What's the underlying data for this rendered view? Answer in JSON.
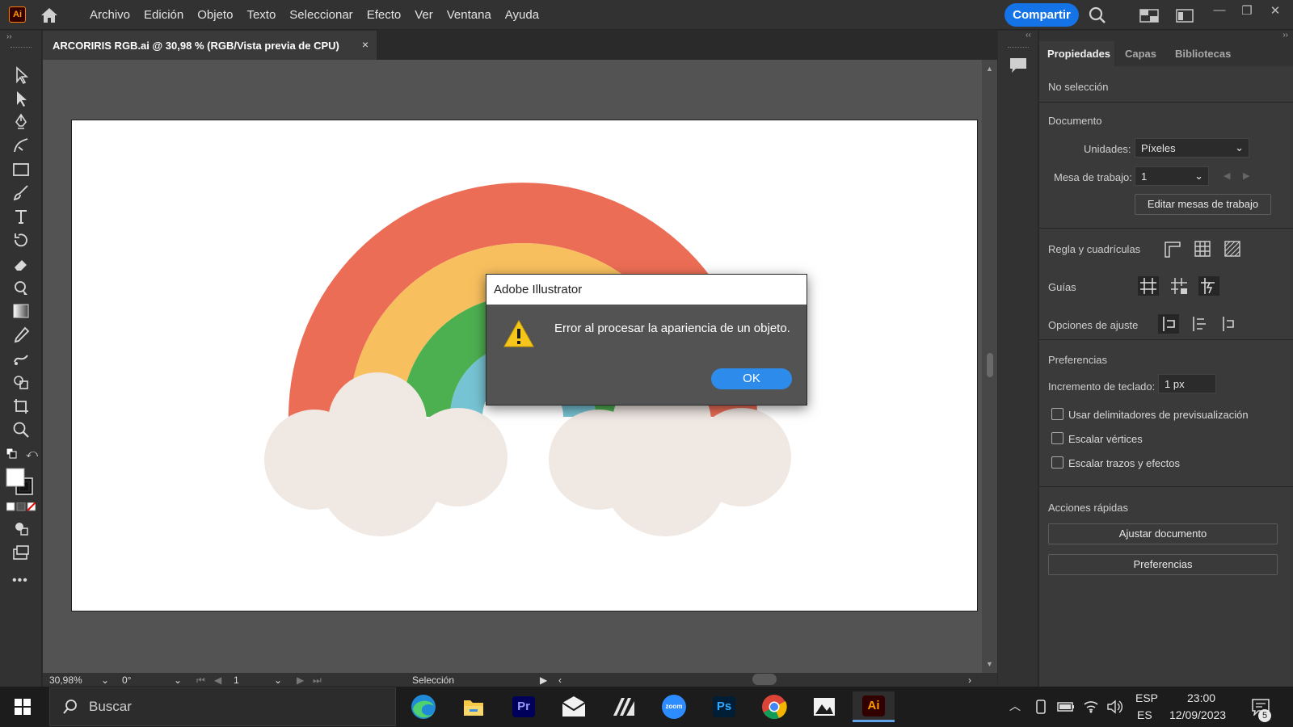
{
  "app": {
    "logo_text": "Ai",
    "menus": [
      "Archivo",
      "Edición",
      "Objeto",
      "Texto",
      "Seleccionar",
      "Efecto",
      "Ver",
      "Ventana",
      "Ayuda"
    ],
    "share_label": "Compartir"
  },
  "document_tab": {
    "title": "ARCORIRIS RGB.ai @ 30,98 % (RGB/Vista previa de CPU)",
    "close": "×"
  },
  "statusbar": {
    "zoom": "30,98%",
    "rotation": "0°",
    "artboard_number": "1",
    "tool_name": "Selección"
  },
  "panel": {
    "tabs": [
      "Propiedades",
      "Capas",
      "Bibliotecas"
    ],
    "active_tab": "Propiedades",
    "no_selection": "No selección",
    "documento": "Documento",
    "units_label": "Unidades:",
    "units_value": "Píxeles",
    "artboard_label": "Mesa de trabajo:",
    "artboard_value": "1",
    "edit_artboards": "Editar mesas de trabajo",
    "rulers_grids": "Regla y cuadrículas",
    "guides": "Guías",
    "snap_options": "Opciones de ajuste",
    "preferences": "Preferencias",
    "keyboard_increment_label": "Incremento de teclado:",
    "keyboard_increment_value": "1 px",
    "checkboxes": [
      {
        "label": "Usar delimitadores de previsualización",
        "checked": false
      },
      {
        "label": "Escalar vértices",
        "checked": false
      },
      {
        "label": "Escalar trazos y efectos",
        "checked": false
      }
    ],
    "quick_actions": "Acciones rápidas",
    "fit_document": "Ajustar documento",
    "preferences_button": "Preferencias"
  },
  "dialog": {
    "title": "Adobe Illustrator",
    "message": "Error al procesar la apariencia de un objeto.",
    "ok_label": "OK"
  },
  "taskbar": {
    "search_placeholder": "Buscar",
    "apps": [
      "edge-icon",
      "file-explorer-icon",
      "premiere-icon",
      "mail-icon",
      "pen-app-icon",
      "zoom-icon",
      "photoshop-icon",
      "chrome-icon",
      "photos-icon",
      "illustrator-icon"
    ],
    "premiere_text": "Pr",
    "zoom_text": "zoom",
    "photoshop_text": "Ps",
    "illustrator_text": "Ai",
    "language_top": "ESP",
    "language_bottom": "ES",
    "time": "23:00",
    "date": "12/09/2023",
    "notification_count": "5"
  },
  "colors": {
    "rainbow_red": "#ec6d55",
    "rainbow_yellow": "#f7bf5e",
    "rainbow_green": "#4caf50",
    "rainbow_blue": "#76c3d3",
    "cloud": "#f0e8e2",
    "accent": "#1473e6"
  }
}
